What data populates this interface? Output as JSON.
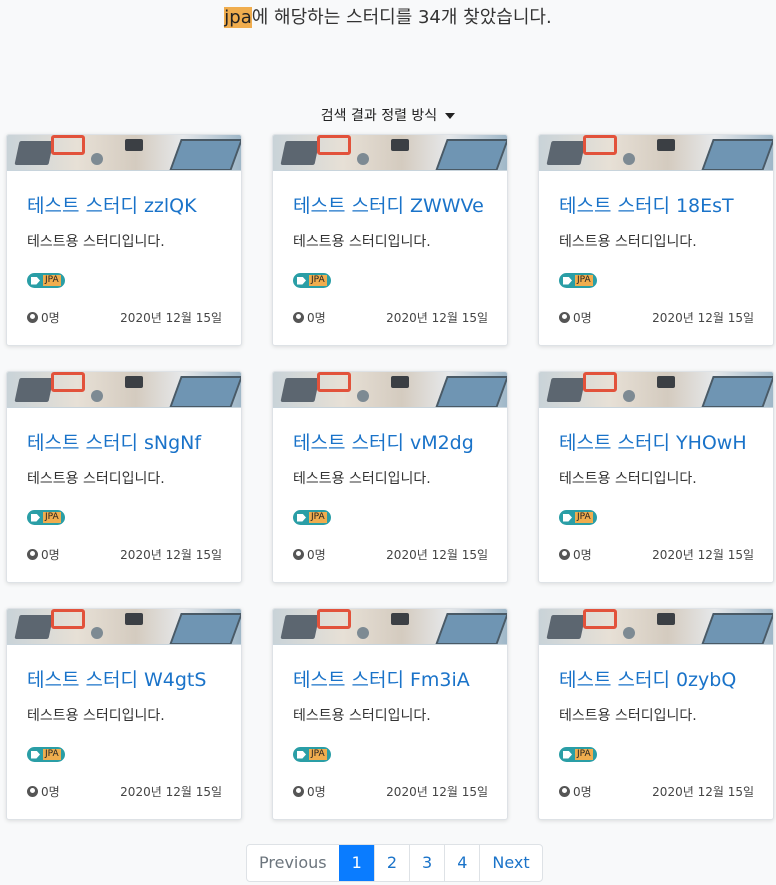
{
  "search_summary": {
    "keyword": "jpa",
    "suffix": "에 해당하는 스터디를 34개 찾았습니다."
  },
  "sort": {
    "label": "검색 결과 정렬 방식"
  },
  "cards": [
    {
      "title": "테스트 스터디 zzlQK",
      "description": "테스트용 스터디입니다.",
      "tag": "JPA",
      "members": "0명",
      "date": "2020년 12월 15일"
    },
    {
      "title": "테스트 스터디 ZWWVe",
      "description": "테스트용 스터디입니다.",
      "tag": "JPA",
      "members": "0명",
      "date": "2020년 12월 15일"
    },
    {
      "title": "테스트 스터디 18EsT",
      "description": "테스트용 스터디입니다.",
      "tag": "JPA",
      "members": "0명",
      "date": "2020년 12월 15일"
    },
    {
      "title": "테스트 스터디 sNgNf",
      "description": "테스트용 스터디입니다.",
      "tag": "JPA",
      "members": "0명",
      "date": "2020년 12월 15일"
    },
    {
      "title": "테스트 스터디 vM2dg",
      "description": "테스트용 스터디입니다.",
      "tag": "JPA",
      "members": "0명",
      "date": "2020년 12월 15일"
    },
    {
      "title": "테스트 스터디 YHOwH",
      "description": "테스트용 스터디입니다.",
      "tag": "JPA",
      "members": "0명",
      "date": "2020년 12월 15일"
    },
    {
      "title": "테스트 스터디 W4gtS",
      "description": "테스트용 스터디입니다.",
      "tag": "JPA",
      "members": "0명",
      "date": "2020년 12월 15일"
    },
    {
      "title": "테스트 스터디 Fm3iA",
      "description": "테스트용 스터디입니다.",
      "tag": "JPA",
      "members": "0명",
      "date": "2020년 12월 15일"
    },
    {
      "title": "테스트 스터디 0zybQ",
      "description": "테스트용 스터디입니다.",
      "tag": "JPA",
      "members": "0명",
      "date": "2020년 12월 15일"
    }
  ],
  "pagination": {
    "previous": "Previous",
    "pages": [
      "1",
      "2",
      "3",
      "4"
    ],
    "active_page": "1",
    "next": "Next"
  },
  "colors": {
    "keyword_highlight": "#f0ad4e",
    "title_link": "#1a73c9",
    "tag_badge": "#2a9ea6",
    "active_page": "#0a7cff"
  },
  "icons": {
    "tag": "tag-icon",
    "members": "user-circle-icon",
    "sort": "caret-down-icon"
  }
}
